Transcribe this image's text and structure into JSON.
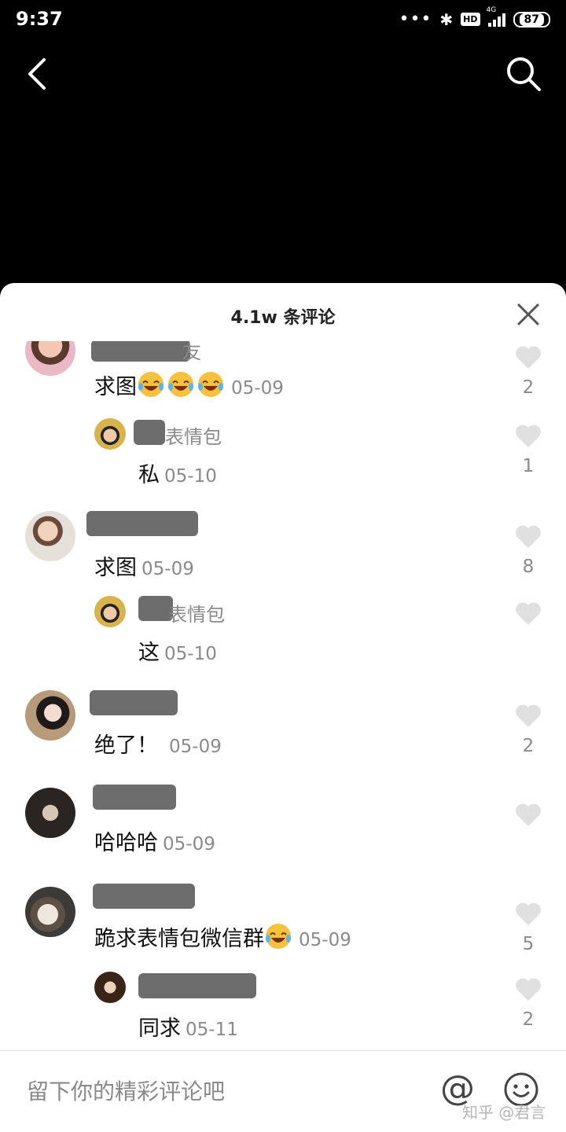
{
  "status_bar": {
    "time": "9:37",
    "hd": "HD",
    "network": "4G",
    "battery": "87"
  },
  "sheet": {
    "title": "4.1w 条评论"
  },
  "comments": [
    {
      "text": "求图",
      "date": "05-09",
      "emoji_count": 3,
      "likes": "2",
      "name_tail": "友"
    },
    {
      "text": "私",
      "date": "05-10",
      "likes": "1",
      "name_tail": "表情包"
    },
    {
      "text": "求图",
      "date": "05-09",
      "likes": "8"
    },
    {
      "text": "这",
      "date": "05-10",
      "likes": "",
      "name_tail": "表情包"
    },
    {
      "text": "绝了！",
      "date": "05-09",
      "likes": "2"
    },
    {
      "text": "哈哈哈",
      "date": "05-09",
      "likes": ""
    },
    {
      "text": "跪求表情包微信群",
      "date": "05-09",
      "emoji_count": 1,
      "likes": "5"
    },
    {
      "text": "同求",
      "date": "05-11",
      "likes": "2"
    }
  ],
  "input_bar": {
    "placeholder": "留下你的精彩评论吧",
    "at_label": "@",
    "watermark": "知乎 @君言"
  },
  "colors": {
    "sheet_bg": "#ffffff",
    "muted_text": "#8a8a8a",
    "heart": "#e0e0e0",
    "emoji": "#f6c23e"
  },
  "icons": [
    "back-arrow-icon",
    "search-icon",
    "close-icon",
    "heart-icon",
    "laugh-cry-emoji-icon",
    "at-icon",
    "smiley-icon",
    "bluetooth-icon",
    "signal-icon",
    "battery-icon"
  ]
}
